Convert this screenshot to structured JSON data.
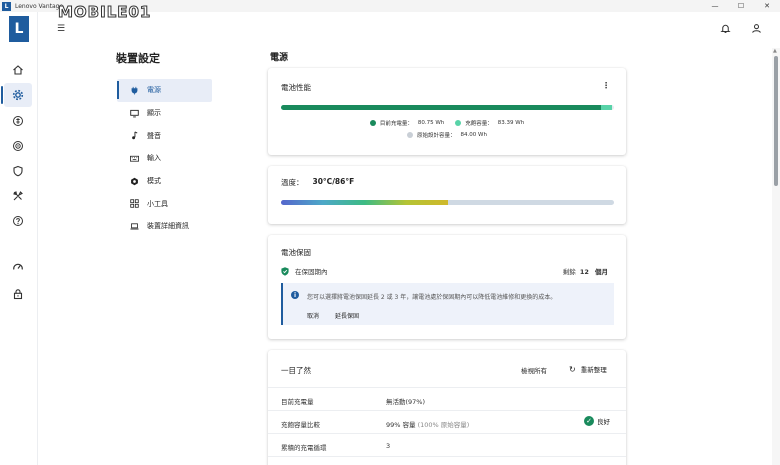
{
  "window": {
    "title": "Lenovo Vantage",
    "logo_letter": "L"
  },
  "watermark": {
    "text": "MOBILE01"
  },
  "rail": {
    "brand_letter": "L"
  },
  "menu": {
    "title": "裝置設定",
    "items": [
      {
        "label": "電源",
        "icon": "plug-icon"
      },
      {
        "label": "顯示",
        "icon": "monitor-icon"
      },
      {
        "label": "聲音",
        "icon": "music-note-icon"
      },
      {
        "label": "輸入",
        "icon": "keyboard-icon"
      },
      {
        "label": "模式",
        "icon": "hexagon-icon"
      },
      {
        "label": "小工具",
        "icon": "widgets-icon"
      },
      {
        "label": "裝置詳細資訊",
        "icon": "laptop-icon"
      }
    ]
  },
  "section_title": "電源",
  "battery_card": {
    "title": "電池性能",
    "menu_icon": "⋮",
    "current_label": "目前充電量：",
    "current_value": "80.75 Wh",
    "full_label": "充飽容量：",
    "full_value": "83.39 Wh",
    "design_label": "原始設計容量：",
    "design_value": "84.00 Wh",
    "current_wh": 80.75,
    "full_wh": 83.39,
    "design_wh": 84.0,
    "colors": {
      "current": "#198a5c",
      "full": "#58d3a8",
      "design": "#c9cfd6"
    }
  },
  "temperature_card": {
    "label": "溫度：",
    "value": "30°C/86°F",
    "level_fraction": 0.5
  },
  "warranty_card": {
    "title": "電池保固",
    "status": "在保固期內",
    "remaining_label": "剩餘",
    "remaining_value": "12",
    "remaining_unit": "個月",
    "notice_text": "您可以選擇將電池保固延長 2 或 3 年，讓電池處於保固期內可以降低電池維修和更換的成本。",
    "cancel_label": "取消",
    "extend_label": "延長保固"
  },
  "glance_card": {
    "title": "一目了然",
    "view_all": "檢視所有",
    "refresh": "重新整理",
    "rows": [
      {
        "key": "目前充電量",
        "value": "無活動(97%)",
        "extra": ""
      },
      {
        "key": "充飽容量比較",
        "value": "99% 容量",
        "extra": "(100% 原始容量)",
        "badge": "良好"
      },
      {
        "key": "累積的充電循環",
        "value": "3",
        "extra": ""
      }
    ]
  }
}
